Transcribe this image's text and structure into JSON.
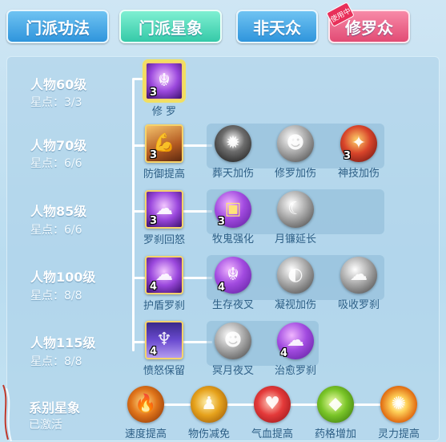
{
  "tabs": [
    {
      "label": "门派功法",
      "style": "blue"
    },
    {
      "label": "门派星象",
      "style": "green",
      "active": true
    },
    {
      "label": "非天众",
      "style": "blue"
    },
    {
      "label": "修罗众",
      "style": "pink",
      "badge": "使用中"
    }
  ],
  "levels": [
    {
      "name": "人物60级",
      "stars": "星点：3/3"
    },
    {
      "name": "人物70级",
      "stars": "星点：6/6"
    },
    {
      "name": "人物85级",
      "stars": "星点：6/6"
    },
    {
      "name": "人物100级",
      "stars": "星点：8/8"
    },
    {
      "name": "人物115级",
      "stars": "星点：8/8"
    }
  ],
  "skills": {
    "r1": [
      {
        "label": "修 罗",
        "level": "3",
        "icon": "demon-head-icon"
      }
    ],
    "r2": [
      {
        "label": "防御提高",
        "level": "3",
        "icon": "arm-strength-icon"
      },
      {
        "label": "葬天加伤",
        "level": "",
        "icon": "dark-burst-icon"
      },
      {
        "label": "修罗加伤",
        "level": "",
        "icon": "grey-demon-icon"
      },
      {
        "label": "神技加伤",
        "level": "3",
        "icon": "red-claw-icon"
      }
    ],
    "r3": [
      {
        "label": "罗刹回怒",
        "level": "3",
        "icon": "purple-beast-icon"
      },
      {
        "label": "牧鬼强化",
        "level": "3",
        "icon": "golden-chest-icon"
      },
      {
        "label": "月镰延长",
        "level": "",
        "icon": "moon-scythe-icon"
      }
    ],
    "r4": [
      {
        "label": "护盾罗刹",
        "level": "4",
        "icon": "purple-shield-beast-icon"
      },
      {
        "label": "生存夜叉",
        "level": "4",
        "icon": "purple-demon-icon"
      },
      {
        "label": "凝视加伤",
        "level": "",
        "icon": "crescent-gaze-icon"
      },
      {
        "label": "吸收罗刹",
        "level": "",
        "icon": "grey-beast-icon"
      }
    ],
    "r5": [
      {
        "label": "愤怒保留",
        "level": "4",
        "icon": "winged-demon-icon"
      },
      {
        "label": "冥月夜叉",
        "level": "",
        "icon": "grey-yaksha-icon"
      },
      {
        "label": "治愈罗刹",
        "level": "4",
        "icon": "purple-heal-beast-icon"
      }
    ]
  },
  "faction": {
    "title": "系别星象",
    "status": "已激活",
    "items": [
      {
        "label": "速度提高",
        "icon": "flame-speed-icon"
      },
      {
        "label": "物伤减免",
        "icon": "golden-figure-icon"
      },
      {
        "label": "气血提高",
        "icon": "heart-icon"
      },
      {
        "label": "药格增加",
        "icon": "green-gem-icon"
      },
      {
        "label": "灵力提高",
        "icon": "sun-burst-icon"
      }
    ]
  }
}
